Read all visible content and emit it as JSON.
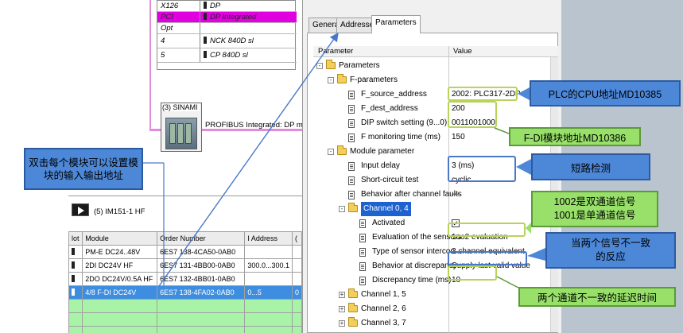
{
  "rack": {
    "rows": [
      {
        "slot": "X126",
        "module": "DP"
      },
      {
        "slot": "PCI",
        "module": "DP Integrated"
      },
      {
        "slot": "Opt",
        "module": ""
      },
      {
        "slot": "4",
        "module": "NCK 840D sl"
      },
      {
        "slot": "5",
        "module": "CP 840D sl"
      }
    ]
  },
  "dp_slave": {
    "label": "(3) SINAMI",
    "profibus": "PROFIBUS Integrated: DP maste"
  },
  "detail": {
    "slave_title": "(5)   IM151-1 HF",
    "table": {
      "headers": [
        "lot",
        "Module",
        "Order Number",
        "I Address",
        "("
      ],
      "rows": [
        {
          "slot": "",
          "module": "PM-E DC24..48V",
          "order": "6ES7 138-4CA50-0AB0",
          "iaddr": "",
          "x": ""
        },
        {
          "slot": "",
          "module": "2DI DC24V HF",
          "order": "6ES7 131-4BB00-0AB0",
          "iaddr": "300.0...300.1",
          "x": ""
        },
        {
          "slot": "",
          "module": "2DO DC24V/0.5A HF",
          "order": "6ES7 132-4BB01-0AB0",
          "iaddr": "",
          "x": ""
        },
        {
          "slot": "",
          "module": "4/8 F-DI DC24V",
          "order": "6ES7 138-4FA02-0AB0",
          "iaddr": "0...5",
          "x": "0"
        }
      ]
    }
  },
  "dialog": {
    "tabs": [
      "General",
      "Addresses",
      "Parameters"
    ],
    "active_tab": "Parameters",
    "columns": {
      "parameter": "Parameter",
      "value": "Value"
    },
    "tree": [
      {
        "label": "Parameters",
        "value": "",
        "kind": "folder",
        "expander": "-",
        "level": 0
      },
      {
        "label": "F-parameters",
        "value": "",
        "kind": "folder",
        "expander": "-",
        "level": 1
      },
      {
        "label": "F_source_address",
        "value": "2002: PLC317-2DP",
        "kind": "doc",
        "level": 2
      },
      {
        "label": "F_dest_address",
        "value": "200",
        "kind": "doc",
        "level": 2
      },
      {
        "label": "DIP switch setting (9...0)",
        "value": "0011001000",
        "kind": "doc",
        "level": 2
      },
      {
        "label": "F monitoring time (ms)",
        "value": "150",
        "kind": "doc",
        "level": 2
      },
      {
        "label": "Module parameter",
        "value": "",
        "kind": "folder",
        "expander": "-",
        "level": 1
      },
      {
        "label": "Input delay",
        "value": "3 (ms)",
        "kind": "doc",
        "level": 2
      },
      {
        "label": "Short-circuit test",
        "value": "cyclic",
        "kind": "doc",
        "level": 2
      },
      {
        "label": "Behavior after channel faults",
        "value": "---",
        "kind": "doc",
        "level": 2
      },
      {
        "label": "Channel 0, 4",
        "value": "",
        "kind": "folder",
        "expander": "-",
        "level": 2,
        "selected": true
      },
      {
        "label": "Activated",
        "value": "",
        "kind": "doc",
        "level": 3,
        "checkbox": true,
        "checked": true
      },
      {
        "label": "Evaluation of the sensors",
        "value": "1oo2 evaluation",
        "kind": "doc",
        "level": 3
      },
      {
        "label": "Type of sensor intercon...",
        "value": "2 channel equivalent",
        "kind": "doc",
        "level": 3
      },
      {
        "label": "Behavior at discrepancy",
        "value": "Supply last valid value",
        "kind": "doc",
        "level": 3
      },
      {
        "label": "Discrepancy time (ms)",
        "value": "10",
        "kind": "doc",
        "level": 3
      },
      {
        "label": "Channel 1, 5",
        "value": "",
        "kind": "folder",
        "expander": "+",
        "level": 2
      },
      {
        "label": "Channel 2, 6",
        "value": "",
        "kind": "folder",
        "expander": "+",
        "level": 2
      },
      {
        "label": "Channel 3, 7",
        "value": "",
        "kind": "folder",
        "expander": "+",
        "level": 2
      }
    ]
  },
  "annotations": {
    "double_click": "双击每个模块可以设置模块的输入输出地址",
    "plc_cpu": "PLC的CPU地址MD10385",
    "fdi_addr": "F-DI模块地址MD10386",
    "short_circuit": "短路检测",
    "channel_signal": "1002是双通道信号\n1001是单通道信号",
    "discrepancy_reaction": "当两个信号不一致\n的反应",
    "delay_time": "两个通道不一致的延迟时间"
  },
  "colors": {
    "selection_magenta": "#e000e0",
    "selection_blue": "#1e62d0",
    "callout_blue": "#4d88d8",
    "callout_green": "#98e06a",
    "highlight_green": "#b7d35a"
  }
}
